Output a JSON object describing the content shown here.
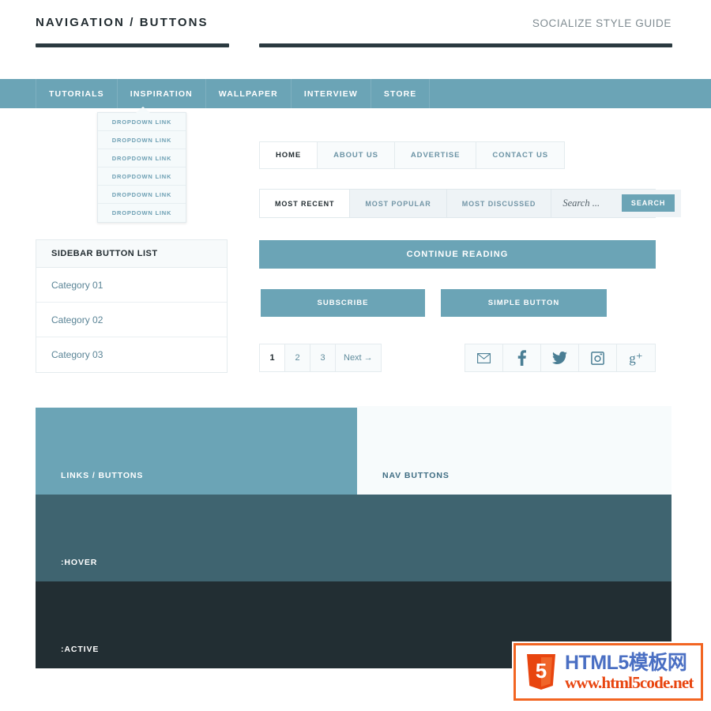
{
  "header": {
    "title": "NAVIGATION / BUTTONS",
    "right_label": "SOCIALIZE STYLE GUIDE"
  },
  "topnav": {
    "items": [
      {
        "label": "TUTORIALS",
        "active": false
      },
      {
        "label": "INSPIRATION",
        "active": true
      },
      {
        "label": "WALLPAPER",
        "active": false
      },
      {
        "label": "INTERVIEW",
        "active": false
      },
      {
        "label": "STORE",
        "active": false
      }
    ]
  },
  "dropdown": {
    "items": [
      {
        "label": "DROPDOWN LINK"
      },
      {
        "label": "DROPDOWN LINK"
      },
      {
        "label": "DROPDOWN LINK"
      },
      {
        "label": "DROPDOWN LINK"
      },
      {
        "label": "DROPDOWN LINK"
      },
      {
        "label": "DROPDOWN LINK"
      }
    ]
  },
  "sidebar": {
    "heading": "SIDEBAR BUTTON LIST",
    "items": [
      {
        "label": "Category 01"
      },
      {
        "label": "Category 02"
      },
      {
        "label": "Category 03"
      }
    ]
  },
  "homenav": {
    "items": [
      {
        "label": "HOME",
        "active": true
      },
      {
        "label": "ABOUT US",
        "active": false
      },
      {
        "label": "ADVERTISE",
        "active": false
      },
      {
        "label": "CONTACT US",
        "active": false
      }
    ]
  },
  "tabbar": {
    "tabs": [
      {
        "label": "MOST RECENT",
        "active": true
      },
      {
        "label": "MOST POPULAR",
        "active": false
      },
      {
        "label": "MOST DISCUSSED",
        "active": false
      }
    ],
    "search_value": "",
    "search_placeholder": "Search ...",
    "search_button": "SEARCH"
  },
  "buttons": {
    "continue_reading": "CONTINUE READING",
    "subscribe": "SUBSCRIBE",
    "simple": "SIMPLE BUTTON"
  },
  "pagination": {
    "items": [
      {
        "label": "1",
        "active": true
      },
      {
        "label": "2",
        "active": false
      },
      {
        "label": "3",
        "active": false
      },
      {
        "label": "Next →",
        "active": false
      }
    ]
  },
  "social": {
    "items": [
      {
        "icon": "mail-icon",
        "glyph": "✉"
      },
      {
        "icon": "facebook-icon",
        "glyph": "f"
      },
      {
        "icon": "twitter-icon",
        "glyph": ""
      },
      {
        "icon": "instagram-icon",
        "glyph": ""
      },
      {
        "icon": "googleplus-icon",
        "glyph": "g⁺"
      }
    ]
  },
  "swatches": {
    "links_buttons": "LINKS / BUTTONS",
    "nav_buttons": "NAV BUTTONS",
    "hover": ":HOVER",
    "active": ":ACTIVE"
  },
  "watermark": {
    "line1": "HTML5模板网",
    "line2": "www.html5code.net",
    "shield_digit": "5"
  },
  "colors": {
    "teal": "#6ba4b6",
    "hover": "#3f6470",
    "active": "#222e33",
    "dark_text": "#222c31",
    "link_blue": "#5a8496"
  }
}
